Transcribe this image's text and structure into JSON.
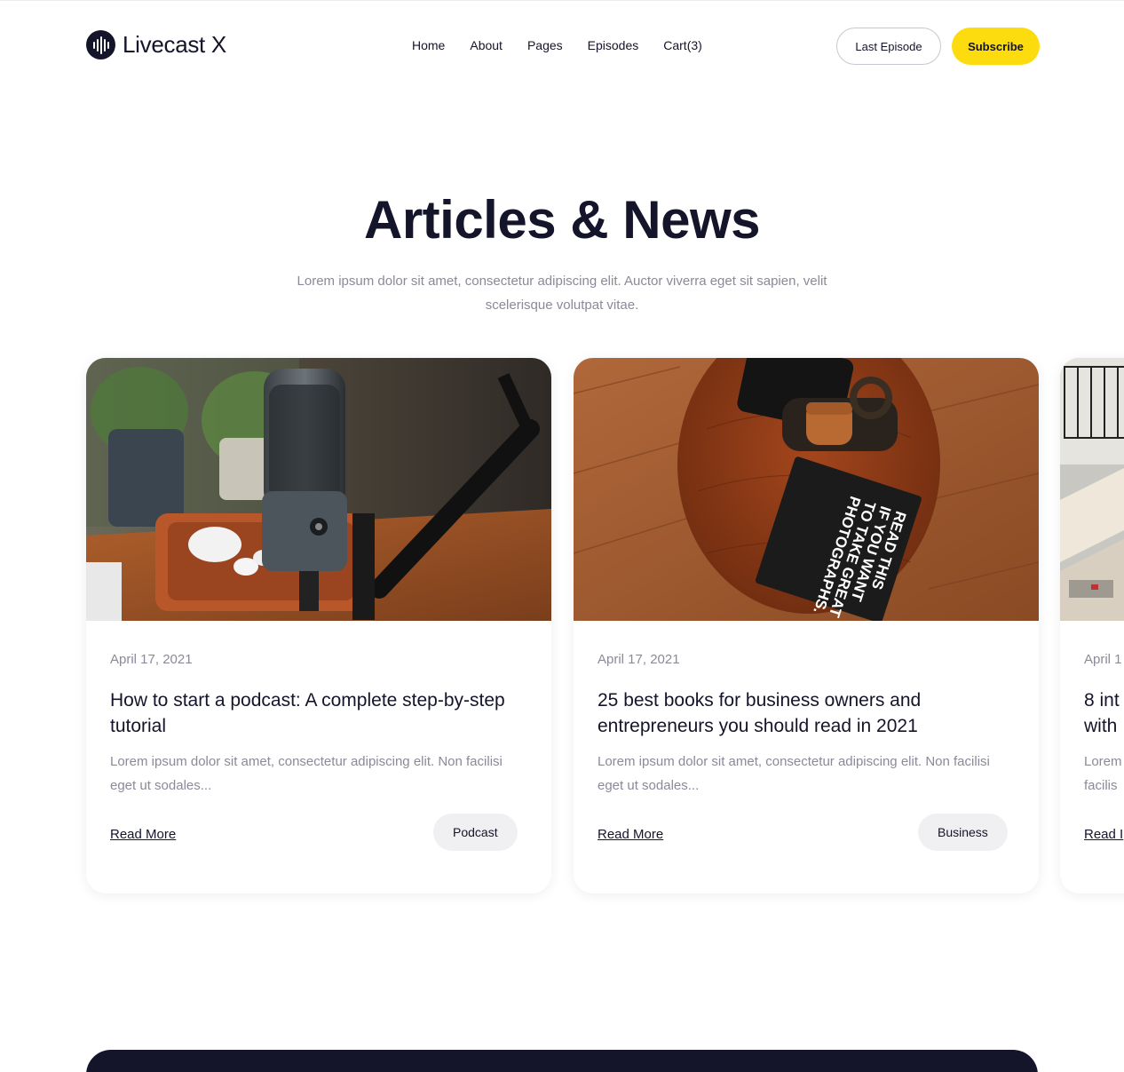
{
  "header": {
    "logo_text": "Livecast X",
    "nav": [
      "Home",
      "About",
      "Pages",
      "Episodes",
      "Cart(3)"
    ],
    "last_episode_label": "Last Episode",
    "subscribe_label": "Subscribe"
  },
  "hero": {
    "title": "Articles & News",
    "subtitle": "Lorem ipsum dolor sit amet, consectetur adipiscing elit. Auctor viverra eget sit sapien, velit scelerisque volutpat vitae."
  },
  "articles": [
    {
      "image": "podcast-microphone-photo",
      "date": "April 17, 2021",
      "title": "How to start a podcast: A complete step-by-step tutorial",
      "excerpt": "Lorem ipsum dolor sit amet, consectetur adipiscing elit. Non facilisi eget ut sodales...",
      "read_more": "Read More",
      "tag": "Podcast"
    },
    {
      "image": "book-on-wooden-table-photo",
      "book_text": "READ THIS IF YOU WANT TO TAKE GREAT PHOTOGRAPHS.",
      "date": "April 17, 2021",
      "title": "25 best books for business owners and entrepreneurs you should read in 2021",
      "excerpt": "Lorem ipsum dolor sit amet, consectetur adipiscing elit. Non facilisi eget ut sodales...",
      "read_more": "Read More",
      "tag": "Business"
    },
    {
      "image": "balcony-building-photo",
      "date": "April 1",
      "title": "8 int with",
      "title_line1": "8 int",
      "title_line2": "with",
      "excerpt_line1": "Lorem",
      "excerpt_line2": "facilis",
      "read_more": "Read I"
    }
  ],
  "colors": {
    "accent": "#fddc0f",
    "dark": "#14142b",
    "muted": "#8a8a99",
    "tag_bg": "#f0f0f3"
  }
}
